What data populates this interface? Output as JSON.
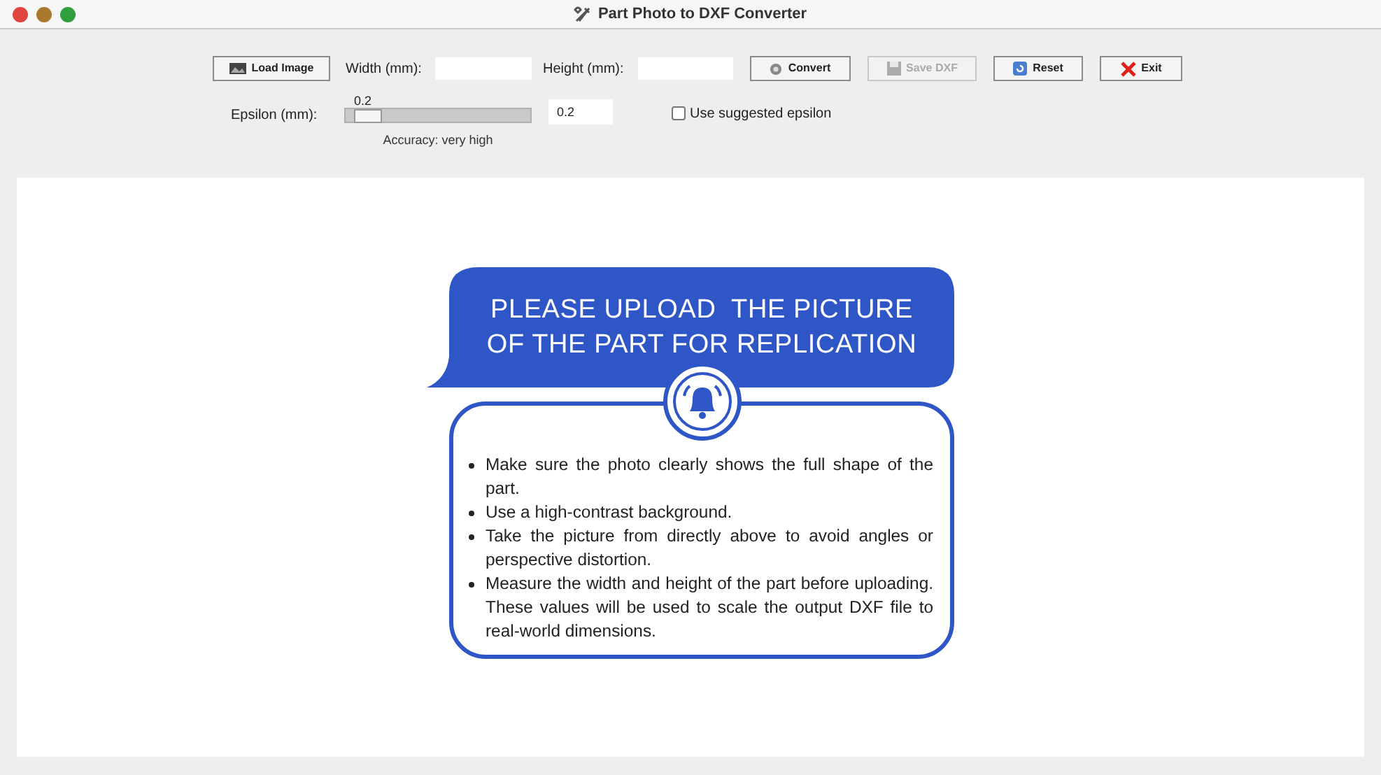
{
  "window": {
    "title": "Part Photo to DXF Converter"
  },
  "toolbar": [
    {
      "kind": "button",
      "label": "Load Image",
      "disabled": false
    },
    {
      "kind": "field",
      "label": "Width (mm):"
    },
    {
      "kind": "field",
      "label": "Height (mm):"
    },
    {
      "kind": "button",
      "label": "Convert",
      "disabled": false
    },
    {
      "kind": "button",
      "label": "Save DXF",
      "disabled": true
    },
    {
      "kind": "button",
      "label": "Reset",
      "disabled": false
    },
    {
      "kind": "button",
      "label": "Exit",
      "disabled": false
    }
  ],
  "epsilon": {
    "label": "Epsilon (mm):",
    "slider_reading": "0.2",
    "level": 0.05,
    "accuracy": "Accuracy: very high",
    "entry": "0.2",
    "suggested": {
      "label": "Use suggested epsilon",
      "checked": false
    }
  },
  "message": {
    "heading_lines": [
      "PLEASE UPLOAD  THE PICTURE",
      "OF THE PART FOR REPLICATION"
    ],
    "tips": [
      "Make sure the photo clearly shows the full shape of the part.",
      "Use a high-contrast background.",
      "Take the picture from directly above to avoid angles or perspective distortion.",
      "Measure the width and height of the part before uploading. These values will be used to scale the output DXF file to real-world dimensions."
    ]
  }
}
